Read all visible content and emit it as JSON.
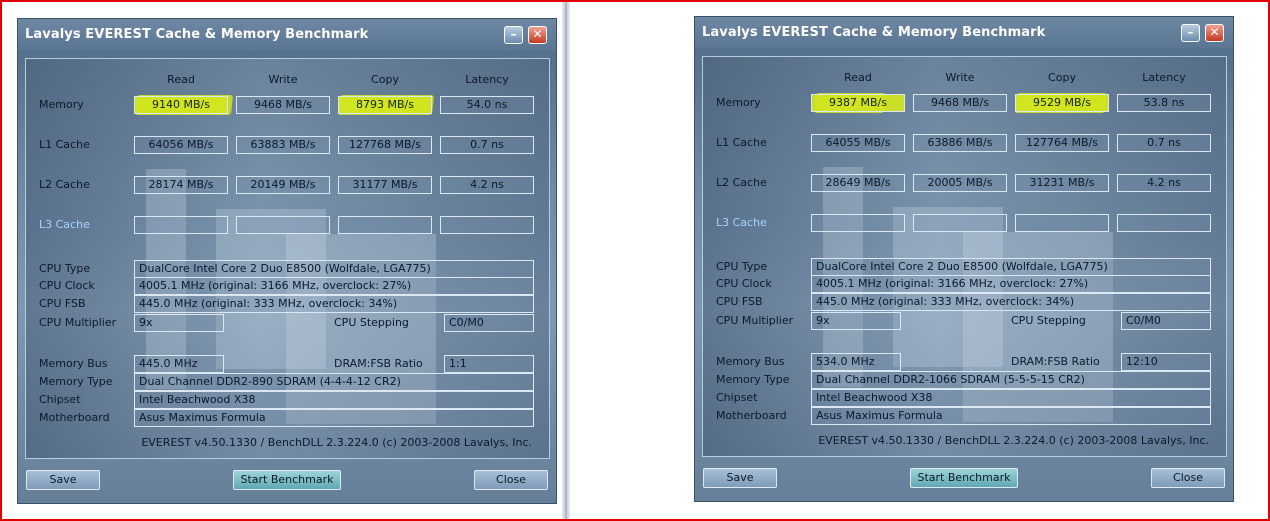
{
  "left": {
    "title": "Lavalys EVEREST Cache & Memory Benchmark",
    "headers": [
      "Read",
      "Write",
      "Copy",
      "Latency"
    ],
    "rows": [
      {
        "label": "Memory",
        "values": [
          "9140 MB/s",
          "9468 MB/s",
          "8793 MB/s",
          "54.0 ns"
        ]
      },
      {
        "label": "L1 Cache",
        "values": [
          "64056 MB/s",
          "63883 MB/s",
          "127768 MB/s",
          "0.7 ns"
        ]
      },
      {
        "label": "L2 Cache",
        "values": [
          "28174 MB/s",
          "20149 MB/s",
          "31177 MB/s",
          "4.2 ns"
        ]
      },
      {
        "label": "L3 Cache",
        "values": [
          "",
          "",
          "",
          ""
        ]
      }
    ],
    "info": {
      "cpu_type_label": "CPU Type",
      "cpu_type": "DualCore Intel Core 2 Duo E8500  (Wolfdale, LGA775)",
      "cpu_clock_label": "CPU Clock",
      "cpu_clock": "4005.1 MHz  (original: 3166 MHz, overclock: 27%)",
      "cpu_fsb_label": "CPU FSB",
      "cpu_fsb": "445.0 MHz  (original: 333 MHz, overclock: 34%)",
      "cpu_mult_label": "CPU Multiplier",
      "cpu_mult": "9x",
      "cpu_stepping_label": "CPU Stepping",
      "cpu_stepping": "C0/M0",
      "mem_bus_label": "Memory Bus",
      "mem_bus": "445.0 MHz",
      "dram_ratio_label": "DRAM:FSB Ratio",
      "dram_ratio": "1:1",
      "mem_type_label": "Memory Type",
      "mem_type": "Dual Channel DDR2-890 SDRAM  (4-4-4-12 CR2)",
      "chipset_label": "Chipset",
      "chipset": "Intel Beachwood X38",
      "motherboard_label": "Motherboard",
      "motherboard": "Asus Maximus Formula"
    },
    "footer": "EVEREST v4.50.1330 / BenchDLL 2.3.224.0  (c) 2003-2008 Lavalys, Inc.",
    "buttons": {
      "save": "Save",
      "start": "Start Benchmark",
      "close": "Close"
    }
  },
  "right": {
    "title": "Lavalys EVEREST Cache & Memory Benchmark",
    "headers": [
      "Read",
      "Write",
      "Copy",
      "Latency"
    ],
    "rows": [
      {
        "label": "Memory",
        "values": [
          "9387 MB/s",
          "9468 MB/s",
          "9529 MB/s",
          "53.8 ns"
        ]
      },
      {
        "label": "L1 Cache",
        "values": [
          "64055 MB/s",
          "63886 MB/s",
          "127764 MB/s",
          "0.7 ns"
        ]
      },
      {
        "label": "L2 Cache",
        "values": [
          "28649 MB/s",
          "20005 MB/s",
          "31231 MB/s",
          "4.2 ns"
        ]
      },
      {
        "label": "L3 Cache",
        "values": [
          "",
          "",
          "",
          ""
        ]
      }
    ],
    "info": {
      "cpu_type_label": "CPU Type",
      "cpu_type": "DualCore Intel Core 2 Duo E8500  (Wolfdale, LGA775)",
      "cpu_clock_label": "CPU Clock",
      "cpu_clock": "4005.1 MHz  (original: 3166 MHz, overclock: 27%)",
      "cpu_fsb_label": "CPU FSB",
      "cpu_fsb": "445.0 MHz  (original: 333 MHz, overclock: 34%)",
      "cpu_mult_label": "CPU Multiplier",
      "cpu_mult": "9x",
      "cpu_stepping_label": "CPU Stepping",
      "cpu_stepping": "C0/M0",
      "mem_bus_label": "Memory Bus",
      "mem_bus": "534.0 MHz",
      "dram_ratio_label": "DRAM:FSB Ratio",
      "dram_ratio": "12:10",
      "mem_type_label": "Memory Type",
      "mem_type": "Dual Channel DDR2-1066 SDRAM  (5-5-5-15 CR2)",
      "chipset_label": "Chipset",
      "chipset": "Intel Beachwood X38",
      "motherboard_label": "Motherboard",
      "motherboard": "Asus Maximus Formula"
    },
    "footer": "EVEREST v4.50.1330 / BenchDLL 2.3.224.0  (c) 2003-2008 Lavalys, Inc.",
    "buttons": {
      "save": "Save",
      "start": "Start Benchmark",
      "close": "Close"
    }
  },
  "colors": {
    "highlight": "#d2e61e",
    "frame": "#e00000",
    "title_text": "#ffffff"
  },
  "icons": {
    "minimize": "minimize-icon",
    "close": "close-icon"
  }
}
